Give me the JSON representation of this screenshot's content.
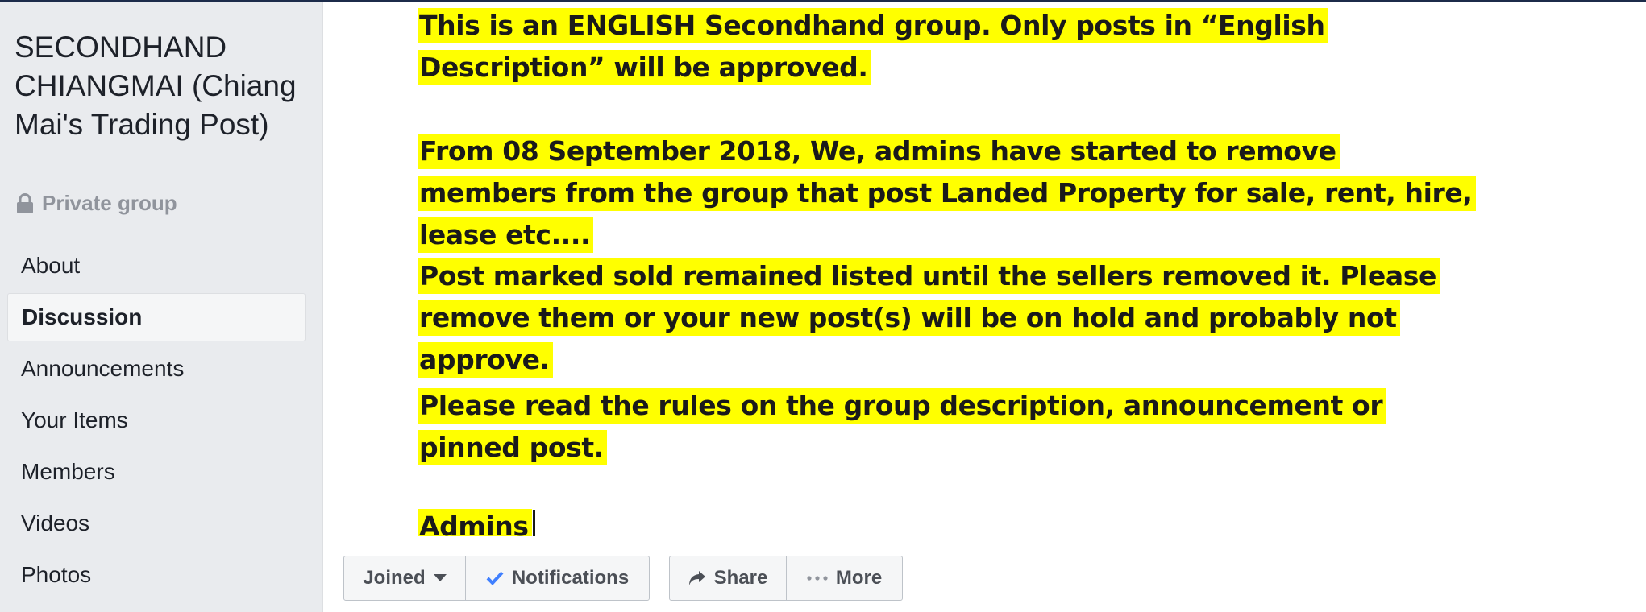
{
  "sidebar": {
    "group_title": "SECONDHAND CHIANGMAI (Chiang Mai's Trading Post)",
    "privacy_label": "Private group",
    "items": [
      {
        "label": "About"
      },
      {
        "label": "Discussion"
      },
      {
        "label": "Announcements"
      },
      {
        "label": "Your Items"
      },
      {
        "label": "Members"
      },
      {
        "label": "Videos"
      },
      {
        "label": "Photos"
      }
    ],
    "active_item": "Discussion"
  },
  "cover": {
    "paragraphs": [
      "This is an ENGLISH Secondhand group. Only posts in “English Description” will be approved.",
      "From 08 September 2018, We, admins have started to remove members from the group that post Landed Property for sale, rent, hire, lease etc....",
      "Post marked sold remained listed until the sellers removed it. Please remove them or your new post(s) will be on hold and probably not approve.",
      "Please read the rules on the group description, announcement or pinned post.",
      "Admins"
    ],
    "highlight_color": "#ffff00"
  },
  "actions": {
    "joined_label": "Joined",
    "notifications_label": "Notifications",
    "share_label": "Share",
    "more_label": "More"
  },
  "icons": {
    "privacy": "lock-icon",
    "joined": "chevron-down-icon",
    "notifications": "checkmark-icon",
    "share": "share-arrow-icon",
    "more": "ellipsis-icon"
  },
  "colors": {
    "sidebar_bg": "#e9ebee",
    "check_blue": "#4080ff",
    "button_text": "#4b4f56"
  }
}
